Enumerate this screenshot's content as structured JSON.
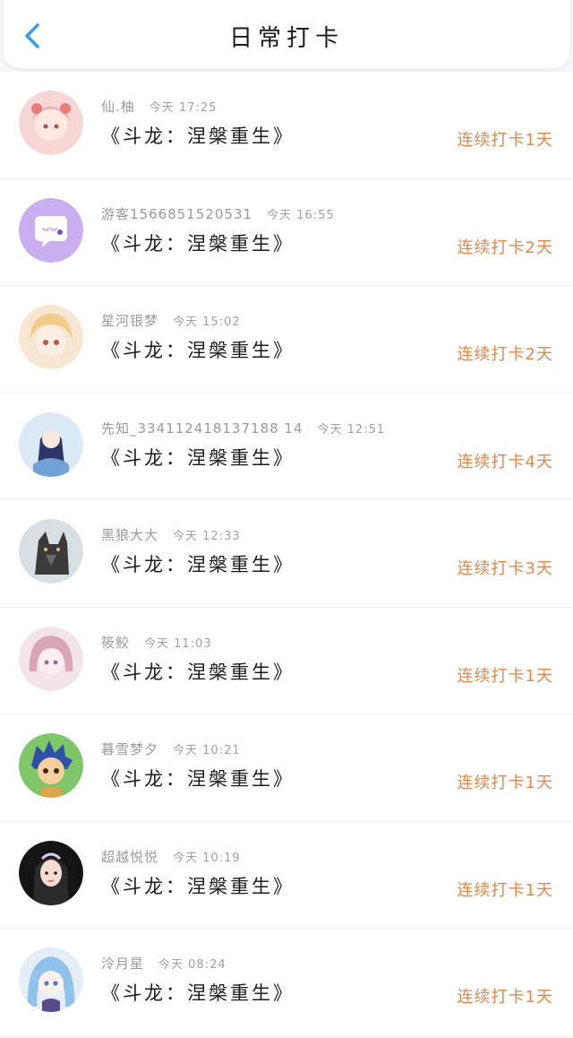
{
  "header": {
    "title": "日常打卡",
    "back_icon": "chevron-left-icon",
    "accent": "#3a9cf0"
  },
  "streak_color": "#e8864a",
  "entries": [
    {
      "user": "仙.柚",
      "time": "今天 17:25",
      "book": "《斗龙：涅槃重生》",
      "streak": "连续打卡1天",
      "avatar": "anime-girl-avatar"
    },
    {
      "user": "游客1566851520531",
      "time": "今天 16:55",
      "book": "《斗龙：涅槃重生》",
      "streak": "连续打卡2天",
      "avatar": "chat-bubble-avatar"
    },
    {
      "user": "星河银梦",
      "time": "今天 15:02",
      "book": "《斗龙：涅槃重生》",
      "streak": "连续打卡2天",
      "avatar": "anime-girl-avatar"
    },
    {
      "user": "先知_334112418137188 14",
      "time": "今天 12:51",
      "book": "《斗龙：涅槃重生》",
      "streak": "连续打卡4天",
      "avatar": "anime-girl-avatar"
    },
    {
      "user": "黑狼大大",
      "time": "今天 12:33",
      "book": "《斗龙：涅槃重生》",
      "streak": "连续打卡3天",
      "avatar": "wolf-avatar"
    },
    {
      "user": "筱鲛",
      "time": "今天 11:03",
      "book": "《斗龙：涅槃重生》",
      "streak": "连续打卡1天",
      "avatar": "anime-girl-avatar"
    },
    {
      "user": "暮雪梦夕",
      "time": "今天 10:21",
      "book": "《斗龙：涅槃重生》",
      "streak": "连续打卡1天",
      "avatar": "anime-boy-avatar"
    },
    {
      "user": "超越悦悦",
      "time": "今天 10:19",
      "book": "《斗龙：涅槃重生》",
      "streak": "连续打卡1天",
      "avatar": "girl-photo-avatar"
    },
    {
      "user": "泠月星",
      "time": "今天 08:24",
      "book": "《斗龙：涅槃重生》",
      "streak": "连续打卡1天",
      "avatar": "anime-girl-avatar"
    }
  ]
}
